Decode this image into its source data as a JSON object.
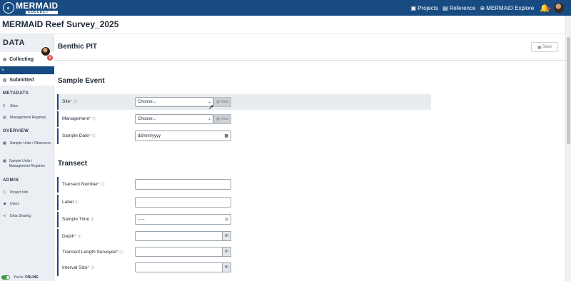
{
  "app": {
    "logo_text": "MERMAID",
    "logo_sub": "COLLECT"
  },
  "nav": {
    "projects": "Projects",
    "reference": "Reference",
    "explore": "MERMAID Explore"
  },
  "project": {
    "title": "MERMAID Reef Survey_2025"
  },
  "sidebar": {
    "data_title": "DATA",
    "badge": "2",
    "collecting": "Collecting",
    "submitted": "Submitted",
    "metadata_heading": "METADATA",
    "sites": "Sites",
    "management_regimes": "Management Regimes",
    "overview_heading": "OVERVIEW",
    "su_observers": "Sample Units / Observers",
    "su_management": "Sample Units / Management Regimes",
    "admin_heading": "ADMIN",
    "project_info": "Project Info",
    "users": "Users",
    "data_sharing": "Data Sharing",
    "online_prefix": "You're",
    "online_status": "ONLINE"
  },
  "form": {
    "title": "Benthic PIT",
    "save": "Save",
    "sample_event_heading": "Sample Event",
    "transect_heading": "Transect",
    "site_label": "Site",
    "site_value": "Choose...",
    "management_label": "Management",
    "management_value": "Choose...",
    "view": "View",
    "sample_date_label": "Sample Date",
    "sample_date_placeholder": "dd/mm/yyyy",
    "transect_number_label": "Transect Number",
    "label_label": "Label",
    "sample_time_label": "Sample Time",
    "sample_time_placeholder": "--:--",
    "depth_label": "Depth",
    "transect_length_label": "Transect Length Surveyed",
    "interval_size_label": "Interval Size",
    "unit_m": "m",
    "required_mark": "*"
  },
  "icons": {
    "info": "info-circle-icon",
    "chevron": "chevron-down-icon",
    "calendar": "calendar-icon",
    "clock": "clock-icon"
  },
  "colors": {
    "brand": "#174b82",
    "required": "#d9534f",
    "online": "#3a9a43"
  }
}
